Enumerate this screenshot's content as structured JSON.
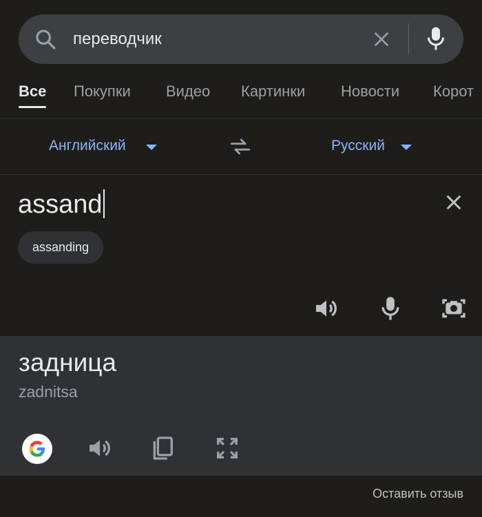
{
  "search": {
    "query": "переводчик"
  },
  "tabs": [
    {
      "label": "Все",
      "active": true
    },
    {
      "label": "Покупки"
    },
    {
      "label": "Видео"
    },
    {
      "label": "Картинки"
    },
    {
      "label": "Новости"
    },
    {
      "label": "Корот"
    }
  ],
  "translator": {
    "source_language": "Английский",
    "target_language": "Русский",
    "source_text": "assand",
    "suggestion": "assanding",
    "result_text": "задница",
    "transliteration": "zadnitsa"
  },
  "footer": {
    "feedback_label": "Оставить отзыв"
  },
  "colors": {
    "background": "#1f1d1a",
    "search_bar": "#3c4043",
    "result_panel": "#303134",
    "link_blue": "#8ab4f8"
  }
}
